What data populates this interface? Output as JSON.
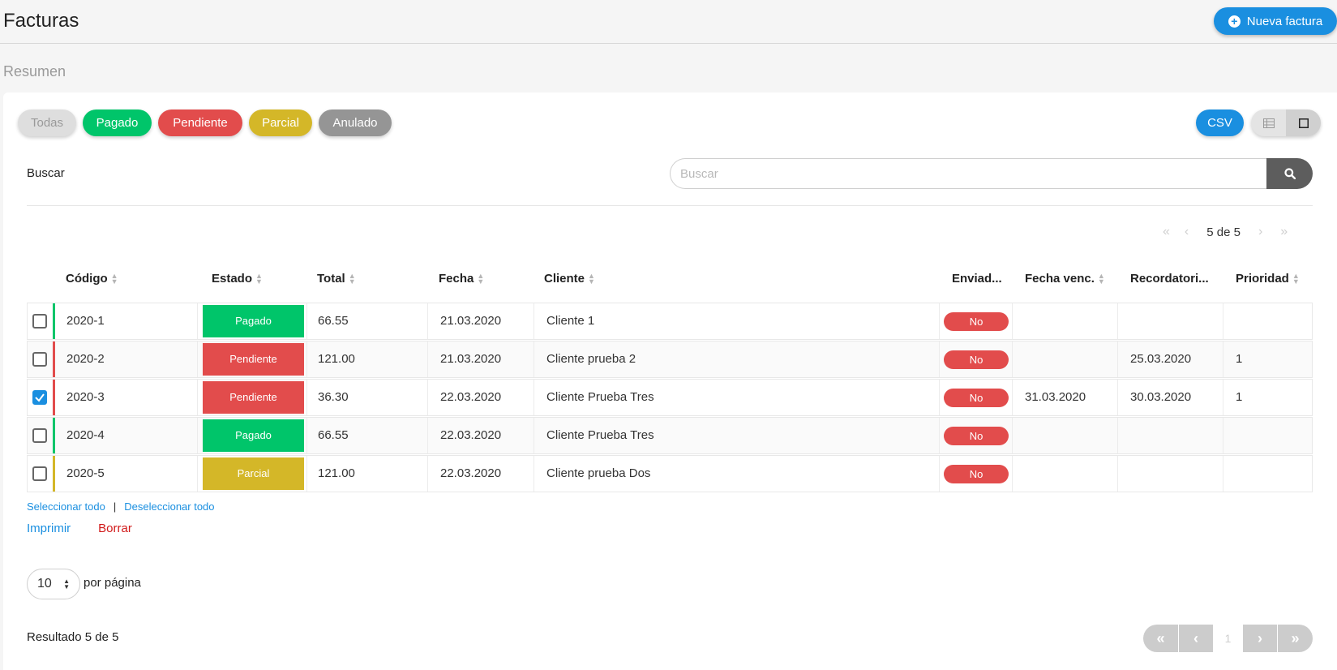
{
  "header": {
    "title": "Facturas",
    "new_button": "Nueva factura",
    "section": "Resumen"
  },
  "filters": {
    "all": "Todas",
    "paid": "Pagado",
    "pending": "Pendiente",
    "partial": "Parcial",
    "void": "Anulado",
    "csv": "CSV"
  },
  "search": {
    "label": "Buscar",
    "placeholder": "Buscar",
    "value": ""
  },
  "top_pager": {
    "text": "5 de 5"
  },
  "columns": {
    "code": "Código",
    "status": "Estado",
    "total": "Total",
    "date": "Fecha",
    "client": "Cliente",
    "sent": "Enviad...",
    "due_date": "Fecha venc.",
    "reminder": "Recordatori...",
    "priority": "Prioridad"
  },
  "rows": [
    {
      "code": "2020-1",
      "status": "Pagado",
      "status_color": "#00c56a",
      "total": "66.55",
      "date": "21.03.2020",
      "client": "Cliente 1",
      "sent": "No",
      "due_date": "",
      "reminder": "",
      "priority": "",
      "checked": false
    },
    {
      "code": "2020-2",
      "status": "Pendiente",
      "status_color": "#e24c4c",
      "total": "121.00",
      "date": "21.03.2020",
      "client": "Cliente prueba 2",
      "sent": "No",
      "due_date": "",
      "reminder": "25.03.2020",
      "priority": "1",
      "checked": false
    },
    {
      "code": "2020-3",
      "status": "Pendiente",
      "status_color": "#e24c4c",
      "total": "36.30",
      "date": "22.03.2020",
      "client": "Cliente Prueba Tres",
      "sent": "No",
      "due_date": "31.03.2020",
      "reminder": "30.03.2020",
      "priority": "1",
      "checked": true
    },
    {
      "code": "2020-4",
      "status": "Pagado",
      "status_color": "#00c56a",
      "total": "66.55",
      "date": "22.03.2020",
      "client": "Cliente Prueba Tres",
      "sent": "No",
      "due_date": "",
      "reminder": "",
      "priority": "",
      "checked": false
    },
    {
      "code": "2020-5",
      "status": "Parcial",
      "status_color": "#d4b728",
      "total": "121.00",
      "date": "22.03.2020",
      "client": "Cliente prueba Dos",
      "sent": "No",
      "due_date": "",
      "reminder": "",
      "priority": "",
      "checked": false
    }
  ],
  "selection": {
    "select_all": "Seleccionar todo",
    "separator": "|",
    "deselect_all": "Deseleccionar todo"
  },
  "actions": {
    "print": "Imprimir",
    "delete": "Borrar"
  },
  "pagination": {
    "per_page_value": "10",
    "per_page_label": "por página",
    "result": "Resultado 5 de 5",
    "current_page": "1"
  },
  "colors": {
    "accent": "#1a8fe0",
    "paid": "#00c56a",
    "pending": "#e24c4c",
    "partial": "#d4b728",
    "void": "#959595"
  }
}
